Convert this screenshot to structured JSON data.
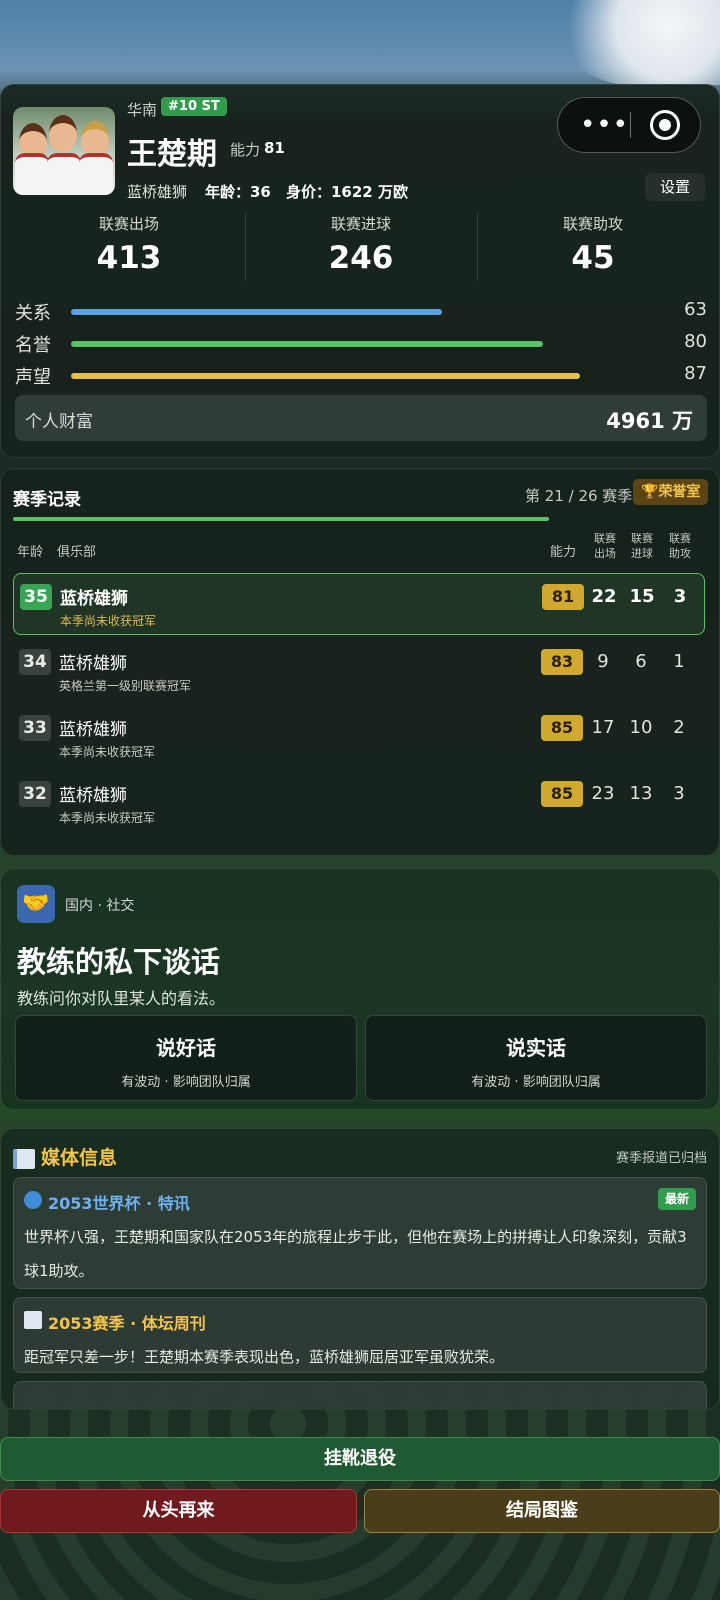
{
  "colors": {
    "accent_green": "#57c266",
    "gold": "#f2c54a",
    "relation": "#5aa3e6",
    "fame": "#57c266",
    "reputation": "#e8c04a"
  },
  "profile": {
    "region": "华南",
    "position_badge": "#10 ST",
    "name": "王楚期",
    "ability_label": "能力",
    "ability_value": "81",
    "club": "蓝桥雄狮",
    "age_text": "年龄：36",
    "value_text": "身价：1622 万欧",
    "settings_label": "设置",
    "stats": [
      {
        "label": "联赛出场",
        "value": "413"
      },
      {
        "label": "联赛进球",
        "value": "246"
      },
      {
        "label": "联赛助攻",
        "value": "45"
      }
    ],
    "bars": [
      {
        "label": "关系",
        "value": "63",
        "level": 0.7,
        "color": "#5aa3e6"
      },
      {
        "label": "名誉",
        "value": "80",
        "level": 0.89,
        "color": "#57c266"
      },
      {
        "label": "声望",
        "value": "87",
        "level": 0.96,
        "color": "#e8c04a"
      }
    ],
    "wealth_label": "个人财富",
    "wealth_value": "4961 万"
  },
  "season": {
    "title": "赛季记录",
    "progress": "第 21 / 26 赛季",
    "progress_fraction": 0.81,
    "honor_label": "荣誉室",
    "headers": {
      "age": "年龄",
      "club": "俱乐部",
      "ability": "能力",
      "apps": "联赛\n出场",
      "goals": "联赛\n进球",
      "assists": "联赛\n助攻"
    },
    "rows": [
      {
        "age": "35",
        "club": "蓝桥雄狮",
        "note": "本季尚未收获冠军",
        "ability": "81",
        "apps": "22",
        "goals": "15",
        "assists": "3",
        "current": true
      },
      {
        "age": "34",
        "club": "蓝桥雄狮",
        "note": "英格兰第一级别联赛冠军",
        "ability": "83",
        "apps": "9",
        "goals": "6",
        "assists": "1",
        "current": false
      },
      {
        "age": "33",
        "club": "蓝桥雄狮",
        "note": "本季尚未收获冠军",
        "ability": "85",
        "apps": "17",
        "goals": "10",
        "assists": "2",
        "current": false
      },
      {
        "age": "32",
        "club": "蓝桥雄狮",
        "note": "本季尚未收获冠军",
        "ability": "85",
        "apps": "23",
        "goals": "13",
        "assists": "3",
        "current": false
      }
    ]
  },
  "event": {
    "icon": "handshake-icon",
    "category": "国内 · 社交",
    "title": "教练的私下谈话",
    "description": "教练问你对队里某人的看法。",
    "choices": [
      {
        "title": "说好话",
        "subtitle": "有波动 · 影响团队归属"
      },
      {
        "title": "说实话",
        "subtitle": "有波动 · 影响团队归属"
      }
    ]
  },
  "media": {
    "title": "媒体信息",
    "status": "赛季报道已归档",
    "items": [
      {
        "header": "2053世界杯 · 特讯",
        "badge": "最新",
        "text": "世界杯八强，王楚期和国家队在2053年的旅程止步于此，但他在赛场上的拼搏让人印象深刻，贡献3球1助攻。",
        "color": "#6fb0f0"
      },
      {
        "header": "2053赛季 · 体坛周刊",
        "text": "距冠军只差一步！王楚期本赛季表现出色，蓝桥雄狮屈居亚军虽败犹荣。",
        "color": "#f2c54a"
      }
    ]
  },
  "buttons": {
    "retire": "挂靴退役",
    "restart": "从头再来",
    "endings": "结局图鉴"
  }
}
